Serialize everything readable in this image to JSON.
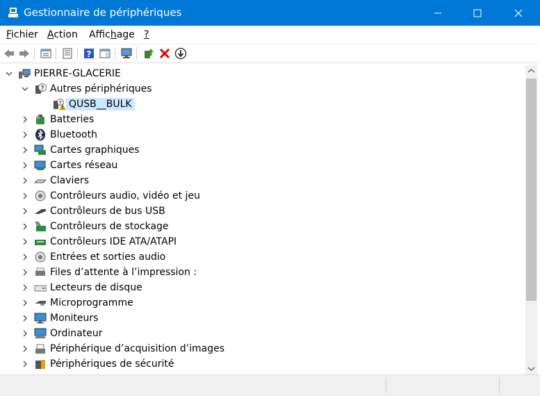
{
  "window": {
    "title": "Gestionnaire de périphériques",
    "accent_color": "#0078d7"
  },
  "menu": [
    {
      "label_prefix": "",
      "label_accel": "F",
      "label_rest": "ichier"
    },
    {
      "label_prefix": "",
      "label_accel": "A",
      "label_rest": "ction"
    },
    {
      "label_prefix": "Affic",
      "label_accel": "h",
      "label_rest": "age"
    },
    {
      "label_prefix": "",
      "label_accel": "?",
      "label_rest": ""
    }
  ],
  "toolbar_icons": [
    "back-arrow-icon",
    "forward-arrow-icon",
    "properties-panel-icon",
    "device-list-icon",
    "help-icon",
    "action-panel-icon",
    "scan-hardware-icon",
    "update-driver-icon",
    "uninstall-device-icon",
    "disable-device-icon"
  ],
  "tree": {
    "root": "PIERRE-GLACERIE",
    "other_devices": {
      "label": "Autres périphériques",
      "child": "QUSB__BULK"
    },
    "categories": [
      "Batteries",
      "Bluetooth",
      "Cartes graphiques",
      "Cartes réseau",
      "Claviers",
      "Contrôleurs audio, vidéo et jeu",
      "Contrôleurs de bus USB",
      "Contrôleurs de stockage",
      "Contrôleurs IDE ATA/ATAPI",
      "Entrées et sorties audio",
      "Files d’attente à l’impression :",
      "Lecteurs de disque",
      "Microprogramme",
      "Moniteurs",
      "Ordinateur",
      "Périphérique d’acquisition d’images",
      "Périphériques de sécurité"
    ]
  }
}
